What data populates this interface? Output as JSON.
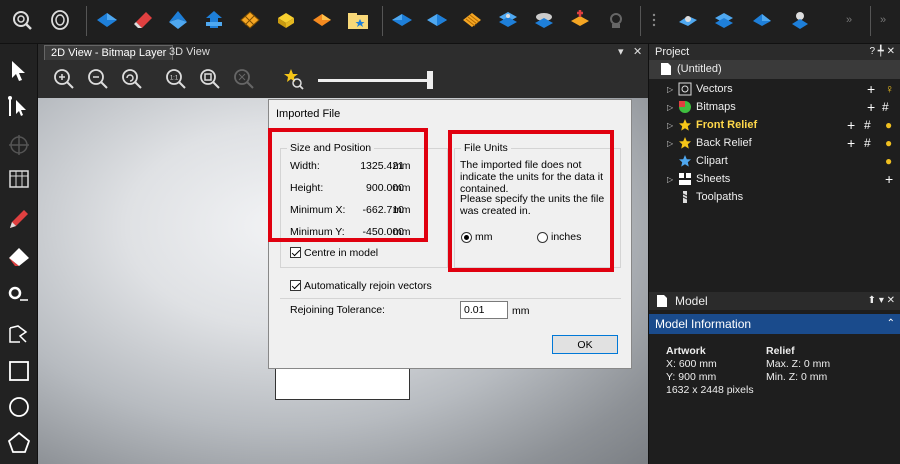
{
  "view_tabs": [
    {
      "label": "2D View - Bitmap Layer"
    },
    {
      "label": "3D View"
    }
  ],
  "view_tab_controls": {
    "dropdown": "▾",
    "close": "✕"
  },
  "toolbar_icons": [
    "rotate-view-icon",
    "preset-view-icon",
    "blue-plane-icon",
    "red-erase-icon",
    "blue-roof-icon",
    "blue-house-icon",
    "mesh-icon",
    "yellow-box-icon",
    "orange-diamond-icon",
    "folder-star-icon",
    "blue-wedge-icon",
    "blue-arrow-icon",
    "orange-grid-icon",
    "stack-icon",
    "orange-star-icon",
    "gray-shape-icon",
    "blue-tool-icon",
    "blue-layers-icon",
    "blue-diamond-icon",
    "blue-bell-icon",
    "overflow-icon"
  ],
  "dialog": {
    "title": "Imported File",
    "size_group": {
      "title": "Size and Position",
      "rows": [
        {
          "label": "Width:",
          "value": "1325.421",
          "unit": "mm"
        },
        {
          "label": "Height:",
          "value": "900.000",
          "unit": "mm"
        },
        {
          "label": "Minimum X:",
          "value": "-662.710",
          "unit": "mm"
        },
        {
          "label": "Minimum Y:",
          "value": "-450.000",
          "unit": "mm"
        }
      ],
      "centre_label": "Centre in model",
      "centre_checked": true
    },
    "units_group": {
      "title": "File Units",
      "message1": "The imported file does not indicate the units for the data it contained.",
      "message2": "Please specify the units the file was created in.",
      "options": [
        {
          "label": "mm",
          "selected": true
        },
        {
          "label": "inches",
          "selected": false
        }
      ]
    },
    "rejoin_label": "Automatically rejoin vectors",
    "rejoin_checked": true,
    "tolerance_label": "Rejoining Tolerance:",
    "tolerance_value": "0.01",
    "tolerance_unit": "mm",
    "ok_label": "OK"
  },
  "project_panel": {
    "title": "Project",
    "controls": "? ╇ ✕",
    "root": "(Untitled)",
    "items": [
      {
        "label": "Vectors",
        "icon": "vectors-icon"
      },
      {
        "label": "Bitmaps",
        "icon": "bitmaps-icon"
      },
      {
        "label": "Front Relief",
        "icon": "star-icon"
      },
      {
        "label": "Back Relief",
        "icon": "star-icon"
      },
      {
        "label": "Clipart",
        "icon": "star-blue-icon"
      },
      {
        "label": "Sheets",
        "icon": "sheets-icon"
      },
      {
        "label": "Toolpaths",
        "icon": "toolpaths-icon"
      }
    ]
  },
  "model_panel": {
    "title": "Model",
    "controls": "⬆ ▾ ✕",
    "info_title": "Model Information",
    "artwork": {
      "heading": "Artwork",
      "x": "X: 600 mm",
      "y": "Y: 900 mm",
      "pixels": "1632 x 2448 pixels"
    },
    "relief": {
      "heading": "Relief",
      "max_z": "Max. Z: 0 mm",
      "min_z": "Min. Z: 0 mm"
    }
  },
  "colors": {
    "highlight": "#e0000f",
    "panel_header": "#1a4b8c",
    "relief_text": "#ffd84a"
  }
}
